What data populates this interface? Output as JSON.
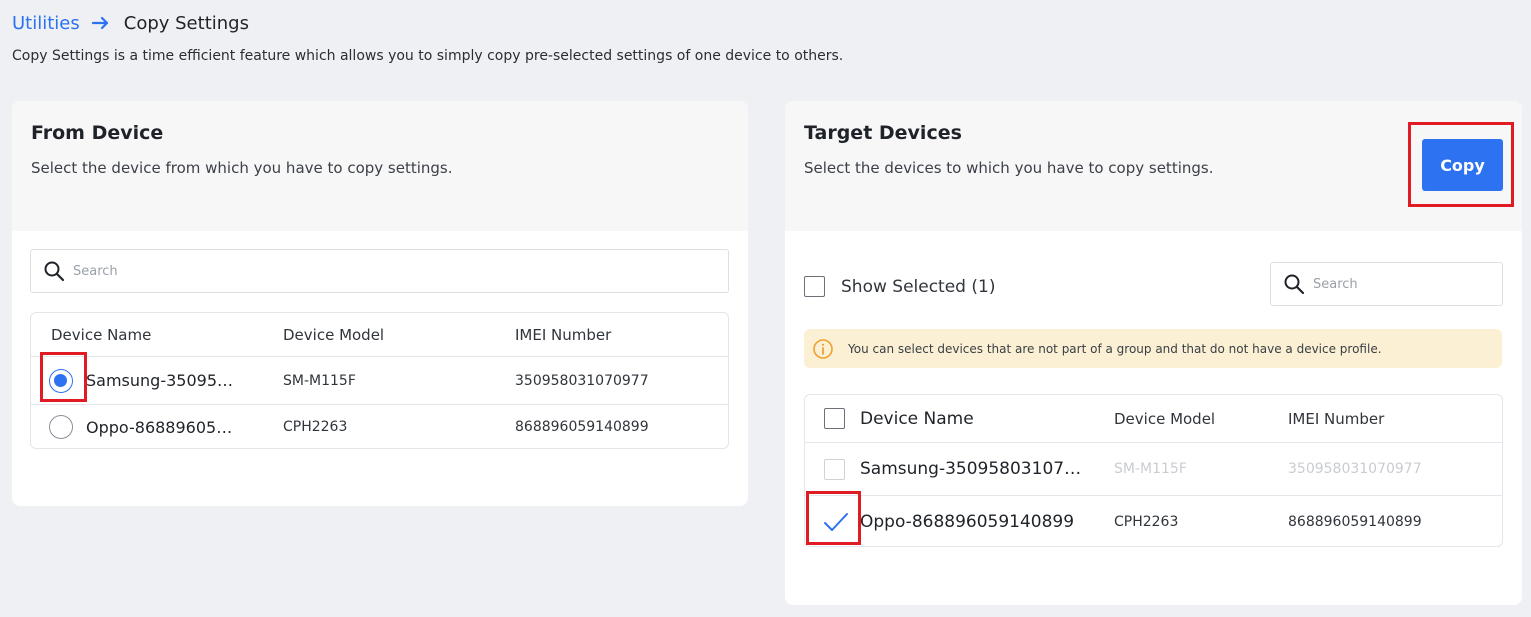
{
  "breadcrumb": {
    "parent": "Utilities",
    "current": "Copy Settings"
  },
  "page": {
    "description": "Copy Settings is a time efficient feature which allows you to simply copy pre-selected settings of one device to others."
  },
  "from_device": {
    "title": "From Device",
    "subtitle": "Select the device from which you have to copy settings.",
    "search_placeholder": "Search",
    "columns": [
      "Device Name",
      "Device Model",
      "IMEI Number"
    ],
    "rows": [
      {
        "name": "Samsung-35095…",
        "model": "SM-M115F",
        "imei": "350958031070977",
        "selected": true
      },
      {
        "name": "Oppo-86889605…",
        "model": "CPH2263",
        "imei": "868896059140899",
        "selected": false
      }
    ]
  },
  "target_devices": {
    "title": "Target Devices",
    "subtitle": "Select the devices to which you have to copy settings.",
    "copy_label": "Copy",
    "show_selected_label": "Show Selected (1)",
    "search_placeholder": "Search",
    "info_text": "You can select devices that are not part of a group and that do not have a device profile.",
    "columns": [
      "Device Name",
      "Device Model",
      "IMEI Number"
    ],
    "rows": [
      {
        "name": "Samsung-35095803107…",
        "model": "SM-M115F",
        "imei": "350958031070977",
        "checked": false,
        "disabled": true
      },
      {
        "name": "Oppo-868896059140899",
        "model": "CPH2263",
        "imei": "868896059140899",
        "checked": true,
        "disabled": false
      }
    ]
  },
  "colors": {
    "accent": "#2d72f0",
    "highlight": "#e01b24",
    "info_bg": "#fbf0d4",
    "info_icon": "#f0a030"
  }
}
